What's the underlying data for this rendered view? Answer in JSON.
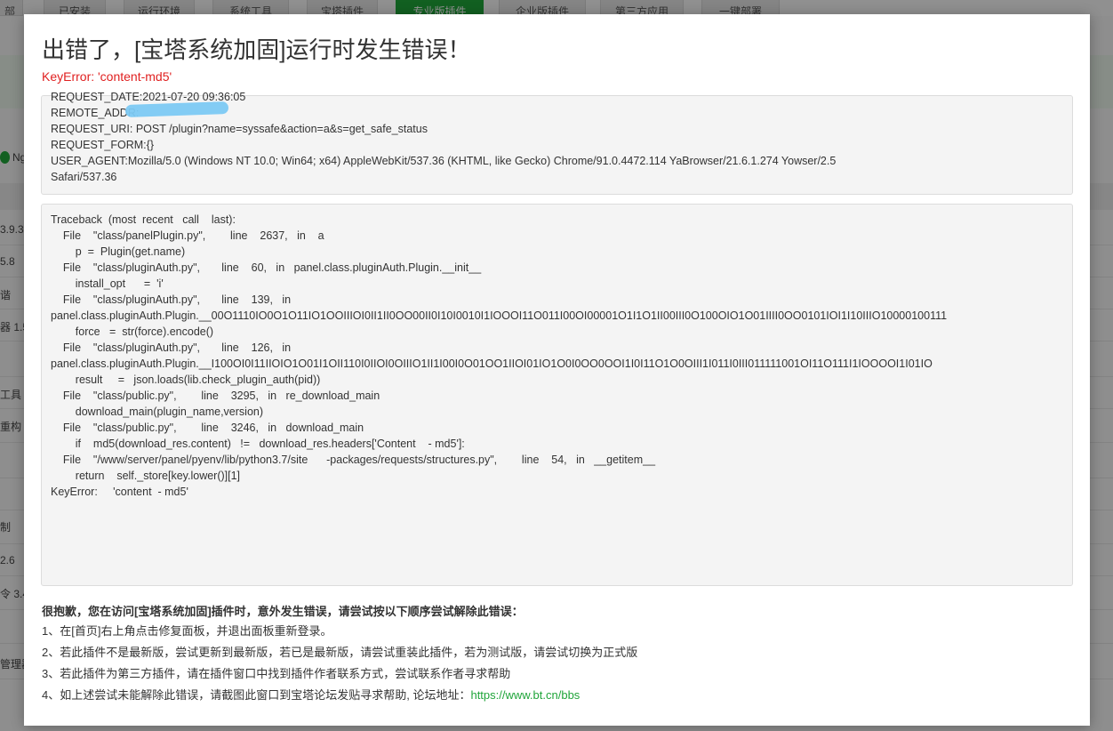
{
  "background": {
    "tabs": [
      "部",
      "已安装",
      "运行环境",
      "系统工具",
      "宝塔插件",
      "专业版插件",
      "企业版插件",
      "第三方应用",
      "一键部署"
    ],
    "active_tab_index": 5,
    "accent_color": "#20a53a",
    "icon_row_text": "Ng",
    "side_cells": [
      "3.9.3",
      "5.8",
      "谐",
      "器 1.5",
      "工具",
      "重构",
      "制",
      "2.6",
      "令 3.4",
      "管理器"
    ]
  },
  "modal": {
    "title": "出错了，[宝塔系统加固]运行时发生错误！",
    "error_summary": "KeyError: 'content-md5'",
    "request": {
      "date": "REQUEST_DATE:2021-07-20  09:36:05",
      "remote_addr": "  REMOTE_ADDR:",
      "uri": "  REQUEST_URI: POST /plugin?name=syssafe&action=a&s=get_safe_status",
      "form": "REQUEST_FORM:{}",
      "user_agent": "    USER_AGENT:Mozilla/5.0    (Windows NT 10.0;    Win64;  x64)   AppleWebKit/537.36  (KHTML,  like    Gecko)  Chrome/91.0.4472.114   YaBrowser/21.6.1.274     Yowser/2.5",
      "user_agent_cont": "Safari/537.36"
    },
    "traceback": [
      "Traceback  (most  recent   call    last):",
      "    File    \"class/panelPlugin.py\",        line    2637,   in    a",
      "        p  =  Plugin(get.name)",
      "    File    \"class/pluginAuth.py\",       line    60,   in   panel.class.pluginAuth.Plugin.__init__",
      "        install_opt      =  'i'",
      "    File    \"class/pluginAuth.py\",       line    139,   in",
      "panel.class.pluginAuth.Plugin.__00O1110IO0O1O11IO1OOIIIOI0II1II0OO00II0I10I0010I1IOOOI11O011I00OI00001O1I1O1II00III0O100OIO1O01IIII0OO0101IOI1I10IIIO10000100111",
      "        force   =  str(force).encode()",
      "    File    \"class/pluginAuth.py\",       line    126,   in",
      "panel.class.pluginAuth.Plugin.__I100OI0I11IIOIO1O01I1OII110I0IIOI0OIIIO1II1I00I0O01OO1IIOI01IO1O0I0OO0OOI1I0I11O1O0OIII1I011I0III011111001OI11O111I1IOOOOI1I01IO",
      "        result     =   json.loads(lib.check_plugin_auth(pid))",
      "    File    \"class/public.py\",        line    3295,   in   re_download_main",
      "        download_main(plugin_name,version)",
      "    File    \"class/public.py\",        line    3246,   in   download_main",
      "        if    md5(download_res.content)   !=   download_res.headers['Content    - md5']:",
      "    File    \"/www/server/panel/pyenv/lib/python3.7/site      -packages/requests/structures.py\",        line    54,   in   __getitem__",
      "        return    self._store[key.lower()][1]",
      "KeyError:     'content  - md5'"
    ],
    "help": {
      "title": "很抱歉，您在访问[宝塔系统加固]插件时，意外发生错误，请尝试按以下顺序尝试解除此错误：",
      "items": [
        "1、在[首页]右上角点击修复面板，并退出面板重新登录。",
        "2、若此插件不是最新版，尝试更新到最新版，若已是最新版，请尝试重装此插件，若为测试版，请尝试切换为正式版",
        "3、若此插件为第三方插件，请在插件窗口中找到插件作者联系方式，尝试联系作者寻求帮助",
        "4、如上述尝试未能解除此错误，请截图此窗口到宝塔论坛发贴寻求帮助, 论坛地址："
      ],
      "forum_link": "https://www.bt.cn/bbs",
      "link_color": "#20a53a"
    }
  }
}
